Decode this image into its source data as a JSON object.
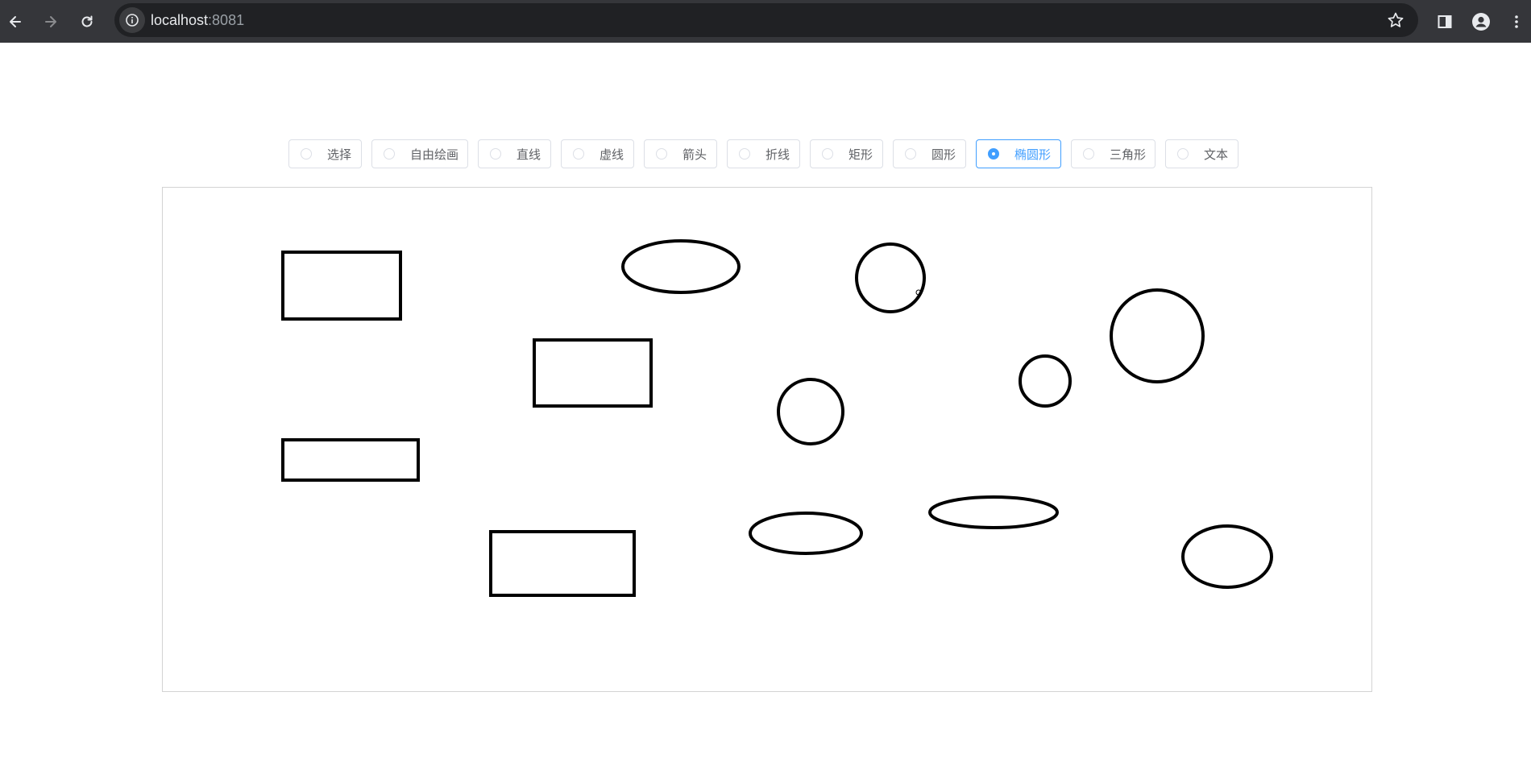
{
  "browser": {
    "url_host": "localhost",
    "url_port": ":8081",
    "icons": {
      "back": "arrow-left-icon",
      "forward": "arrow-right-icon",
      "reload": "reload-icon",
      "site_info": "info-icon",
      "bookmark": "star-icon",
      "side_panel": "side-panel-icon",
      "profile": "person-icon",
      "menu": "kebab-menu-icon"
    }
  },
  "toolbar": {
    "tools": [
      {
        "label": "选择",
        "selected": false
      },
      {
        "label": "自由绘画",
        "selected": false
      },
      {
        "label": "直线",
        "selected": false
      },
      {
        "label": "虚线",
        "selected": false
      },
      {
        "label": "箭头",
        "selected": false
      },
      {
        "label": "折线",
        "selected": false
      },
      {
        "label": "矩形",
        "selected": false
      },
      {
        "label": "圆形",
        "selected": false
      },
      {
        "label": "椭圆形",
        "selected": true
      },
      {
        "label": "三角形",
        "selected": false
      },
      {
        "label": "文本",
        "selected": false
      }
    ],
    "accent_color": "#409eff"
  },
  "canvas": {
    "stroke_color": "#000000"
  }
}
